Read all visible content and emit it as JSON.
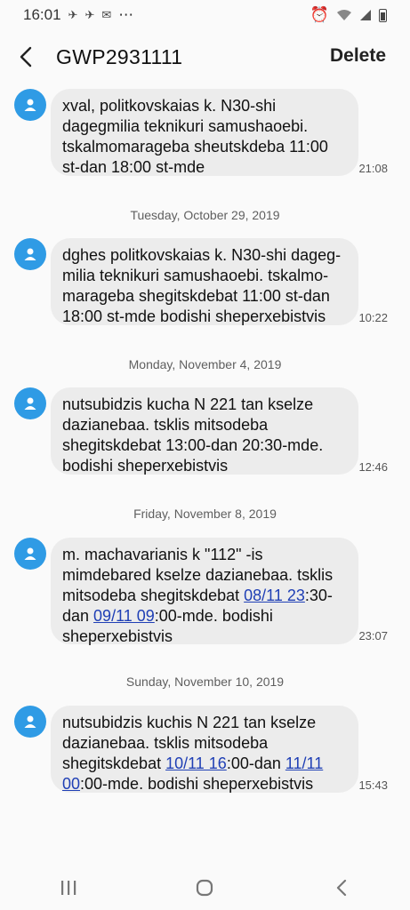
{
  "status_bar": {
    "time": "16:01",
    "extras": "⋯"
  },
  "header": {
    "title": "GWP2931111",
    "delete_label": "Delete"
  },
  "messages": [
    {
      "text": "xval, politkovskaias k. N30-shi dagegmilia teknikuri samushaoebi. tskalmomarageba sheutskdeba 11:00 st-dan 18:00 st-mde",
      "time": "21:08"
    },
    {
      "text": "dghes politkovskaias k. N30-shi dageg-milia teknikuri samushaoebi. tskalmo-marageba shegitskdebat 11:00 st-dan 18:00 st-mde bodishi sheperxebistvis",
      "time": "10:22",
      "date": "Tuesday, October 29, 2019"
    },
    {
      "text": "nutsubidzis kucha N 221 tan kselze dazianebaa. tsklis mitsodeba shegitskdebat 13:00-dan 20:30-mde. bodishi sheperxebistvis",
      "time": "12:46",
      "date": "Monday, November 4, 2019"
    },
    {
      "text_a": "m. machavarianis k \"112\" -is mimdebared kselze dazianebaa. tsklis mitsodeba shegitskdebat ",
      "link1": "08/11 23",
      "text_b": ":30-dan ",
      "link2": "09/11 09",
      "text_c": ":00-mde. bodishi sheperxebistvis",
      "time": "23:07",
      "date": "Friday, November 8, 2019"
    },
    {
      "text_a": "nutsubidzis kuchis N 221 tan kselze dazianebaa. tsklis mitsodeba shegitskdebat ",
      "link1": "10/11 16",
      "text_b": ":00-dan ",
      "link2": "11/11 00",
      "text_c": ":00-mde. bodishi sheperxebistvis",
      "time": "15:43",
      "date": "Sunday, November 10, 2019"
    }
  ],
  "colors": {
    "avatar": "#2f9be5",
    "bubble": "#ececec",
    "link": "#1f3fb5",
    "background": "#fafafa"
  },
  "icons": [
    "back-arrow-icon",
    "contact-avatar-icon",
    "recent-apps-icon",
    "home-icon",
    "back-nav-icon"
  ]
}
